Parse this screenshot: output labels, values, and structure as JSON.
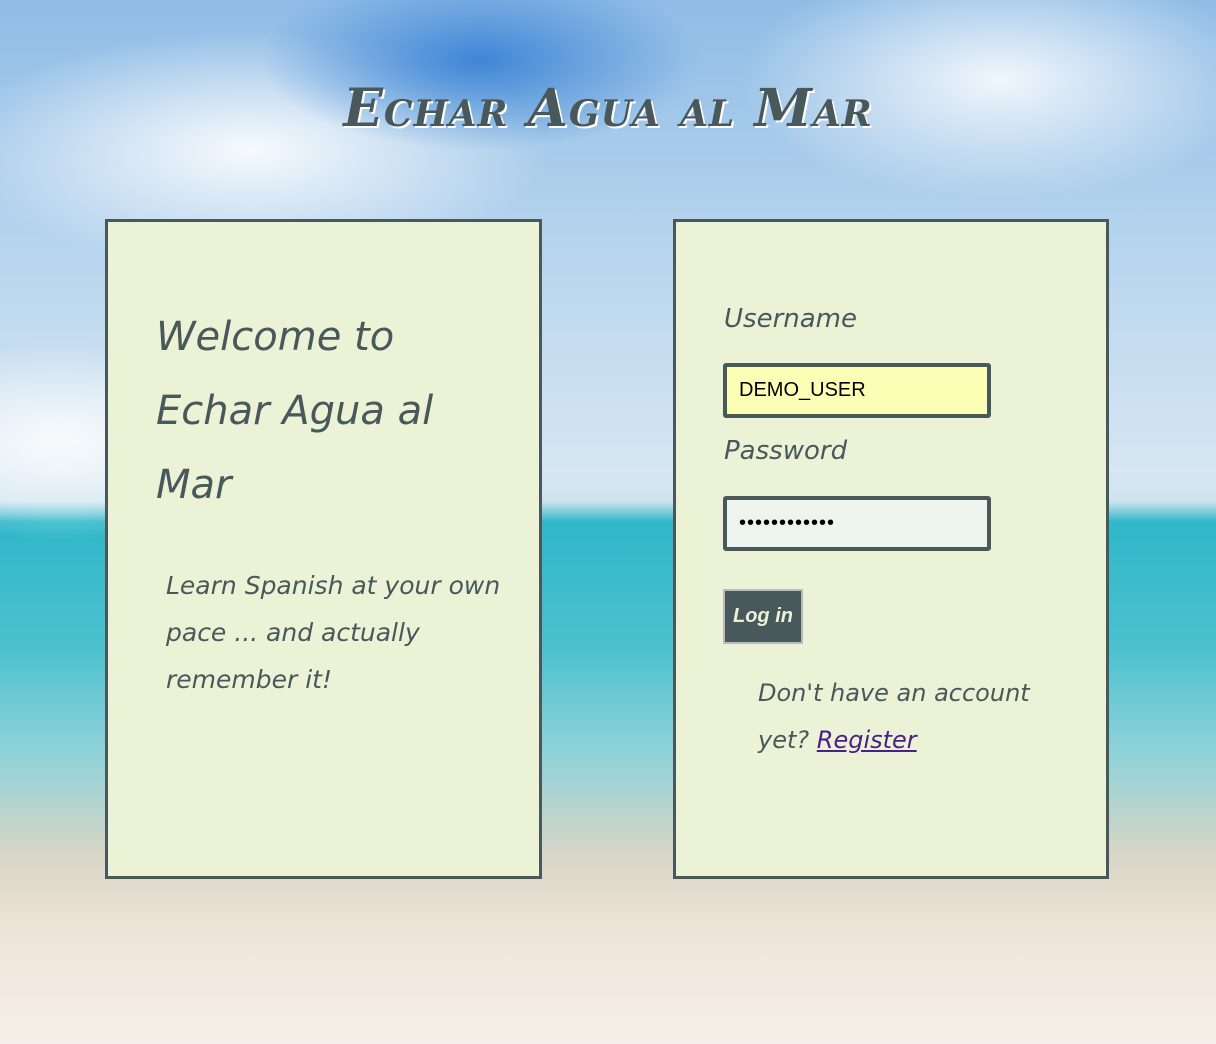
{
  "app": {
    "title": "Echar Agua al Mar"
  },
  "welcome": {
    "heading": "Welcome to Echar Agua al Mar",
    "tagline": "Learn Spanish at your own pace ... and actually remember it!"
  },
  "login": {
    "username_label": "Username",
    "username_value": "DEMO_USER",
    "password_label": "Password",
    "password_value": "••••••••••••",
    "login_button": "Log in",
    "register_prompt": "Don't have an account yet?",
    "register_link": "Register"
  },
  "colors": {
    "text": "#48585b",
    "card": "#ebf2d5",
    "username_bg": "#fbffb6",
    "password_bg": "#eef5ef",
    "link": "#4a1f8a"
  }
}
